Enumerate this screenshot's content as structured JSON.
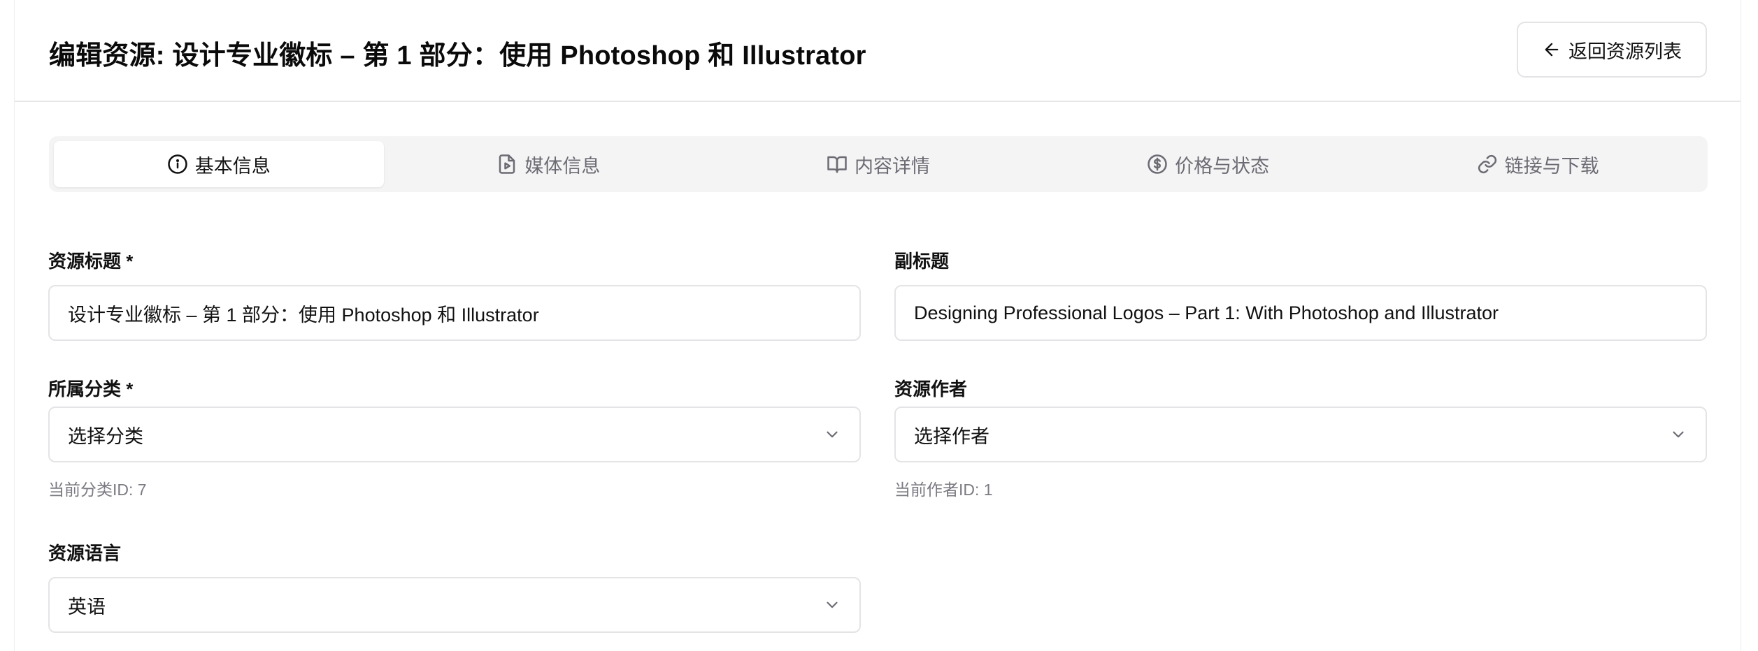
{
  "header": {
    "title": "编辑资源: 设计专业徽标 – 第 1 部分：使用 Photoshop 和 Illustrator",
    "back_label": "返回资源列表"
  },
  "tabs": [
    {
      "label": "基本信息",
      "icon": "info-circle-icon",
      "active": true
    },
    {
      "label": "媒体信息",
      "icon": "file-video-icon",
      "active": false
    },
    {
      "label": "内容详情",
      "icon": "open-book-icon",
      "active": false
    },
    {
      "label": "价格与状态",
      "icon": "dollar-circle-icon",
      "active": false
    },
    {
      "label": "链接与下载",
      "icon": "link-icon",
      "active": false
    }
  ],
  "form": {
    "title_label": "资源标题 *",
    "title_value": "设计专业徽标 – 第 1 部分：使用 Photoshop 和 Illustrator",
    "subtitle_label": "副标题",
    "subtitle_value": "Designing Professional Logos – Part 1: With Photoshop and Illustrator",
    "category_label": "所属分类 *",
    "category_value": "选择分类",
    "category_hint": "当前分类ID: 7",
    "author_label": "资源作者",
    "author_value": "选择作者",
    "author_hint": "当前作者ID: 1",
    "language_label": "资源语言",
    "language_value": "英语"
  }
}
